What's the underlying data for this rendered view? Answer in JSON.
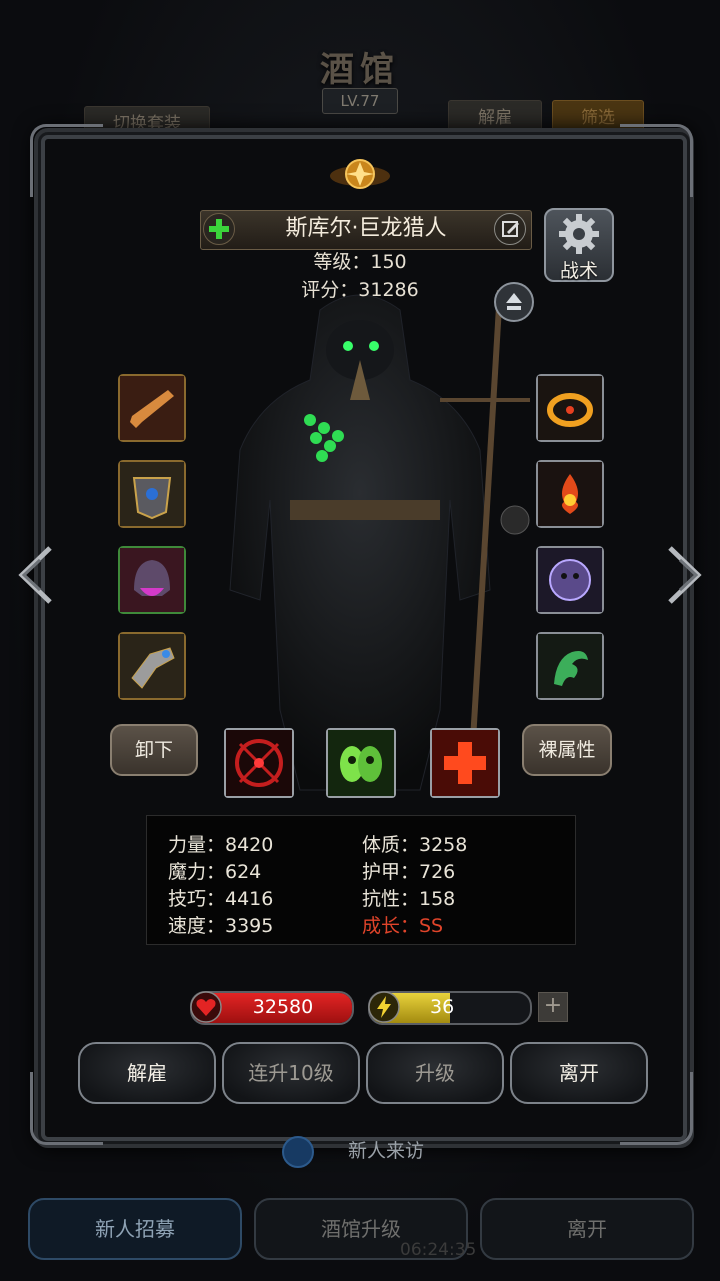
{
  "background": {
    "title": "酒馆",
    "level_badge": "LV.77",
    "switch_outfit": "切换套装",
    "dismiss": "解雇",
    "filter": "筛选",
    "visitor": "新人来访",
    "tabs": [
      "新人招募",
      "酒馆升级",
      "离开"
    ],
    "timer": "06:24:35"
  },
  "hero": {
    "name": "斯库尔·巨龙猎人",
    "level_line": "等级：150",
    "score_line": "评分：31286",
    "tactic_label": "战术"
  },
  "equipment": {
    "left_slots": [
      "weapon-icon",
      "armor-icon",
      "helmet-icon",
      "gauntlet-icon"
    ],
    "right_slots": [
      "fire-ring-icon",
      "flame-amulet-icon",
      "demon-orb-icon",
      "jade-dragon-icon"
    ]
  },
  "actions": {
    "unload": "卸下",
    "naked_attr": "裸属性"
  },
  "skills": [
    "crosshair-skill-icon",
    "green-mask-skill-icon",
    "red-cross-skill-icon"
  ],
  "attributes": {
    "strength": "力量：8420",
    "magic": "魔力：624",
    "skill": "技巧：4416",
    "speed": "速度：3395",
    "constitution": "体质：3258",
    "armor": "护甲：726",
    "resistance": "抗性：158",
    "growth": "成长：SS"
  },
  "bars": {
    "hp_value": "32580",
    "hp_fraction": 1.0,
    "energy_value": "36",
    "energy_fraction": 0.5,
    "plus": "+"
  },
  "buttons": {
    "dismiss": "解雇",
    "level_up_10": "连升10级",
    "level_up": "升级",
    "leave": "离开"
  },
  "colors": {
    "growth_red": "#e0442a",
    "hp_red": "#e32424",
    "energy_yellow": "#e8d23c",
    "gold_frame": "#8a6a2e"
  }
}
